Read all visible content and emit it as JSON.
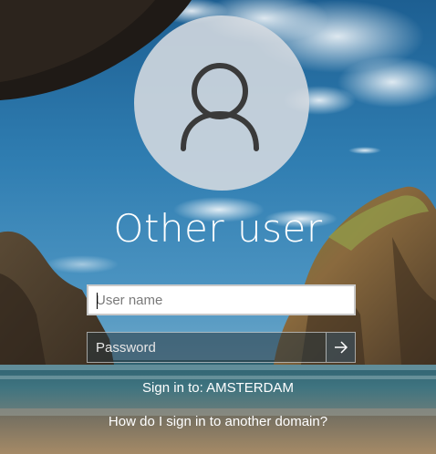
{
  "user_tile": {
    "avatar_icon": "user-icon",
    "name": "Other user"
  },
  "form": {
    "username": {
      "value": "",
      "placeholder": "User name"
    },
    "password": {
      "value": "",
      "placeholder": "Password"
    },
    "submit_icon": "arrow-right-icon"
  },
  "signin_to": "Sign in to: AMSTERDAM",
  "help_link": "How do I sign in to another domain?",
  "colors": {
    "avatar_bg": "#d6dbe0",
    "avatar_glyph": "#3a3a3a",
    "text": "#ffffff"
  }
}
